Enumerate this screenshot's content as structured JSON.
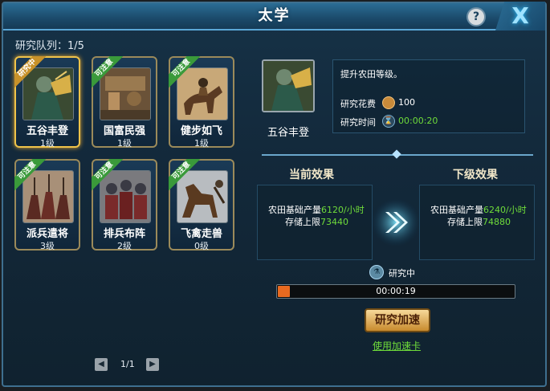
{
  "window": {
    "title": "太学",
    "help_label": "?",
    "close_label": "X"
  },
  "queue": {
    "label": "研究队列：1/5"
  },
  "cards": [
    {
      "name": "五谷丰登",
      "level": "1级",
      "badge": "研究中",
      "badge_color": "#c8922a"
    },
    {
      "name": "国富民强",
      "level": "1级",
      "badge": "可注意",
      "badge_color": "#3a9a3a"
    },
    {
      "name": "健步如飞",
      "level": "1级",
      "badge": "可注意",
      "badge_color": "#3a9a3a"
    },
    {
      "name": "派兵遣将",
      "level": "3级",
      "badge": "可注意",
      "badge_color": "#3a9a3a"
    },
    {
      "name": "排兵布阵",
      "level": "2级",
      "badge": "可注意",
      "badge_color": "#3a9a3a"
    },
    {
      "name": "飞禽走兽",
      "level": "0级",
      "badge": "可注意",
      "badge_color": "#3a9a3a"
    }
  ],
  "pager": {
    "text": "1/1",
    "prev_icon": "◀",
    "next_icon": "▶"
  },
  "detail": {
    "name": "五谷丰登",
    "description": "提升农田等级。",
    "cost_label": "研究花费",
    "cost_value": "100",
    "time_label": "研究时间",
    "time_value": "00:00:20"
  },
  "effects": {
    "current_title": "当前效果",
    "next_title": "下级效果",
    "current": {
      "prod_label": "农田基础产量",
      "prod_value": "6120/小时",
      "store_label": "存储上限",
      "store_value": "73440"
    },
    "next": {
      "prod_label": "农田基础产量",
      "prod_value": "6240/小时",
      "store_label": "存储上限",
      "store_value": "74880"
    }
  },
  "status": {
    "text": "研究中",
    "time_left": "00:00:19",
    "progress_fraction": 0.05
  },
  "actions": {
    "speed_up": "研究加速",
    "use_card": "使用加速卡"
  },
  "colors": {
    "accent_green": "#6fdc3a",
    "progress_orange": "#e86a20",
    "frame_blue": "#3e6f8f"
  }
}
